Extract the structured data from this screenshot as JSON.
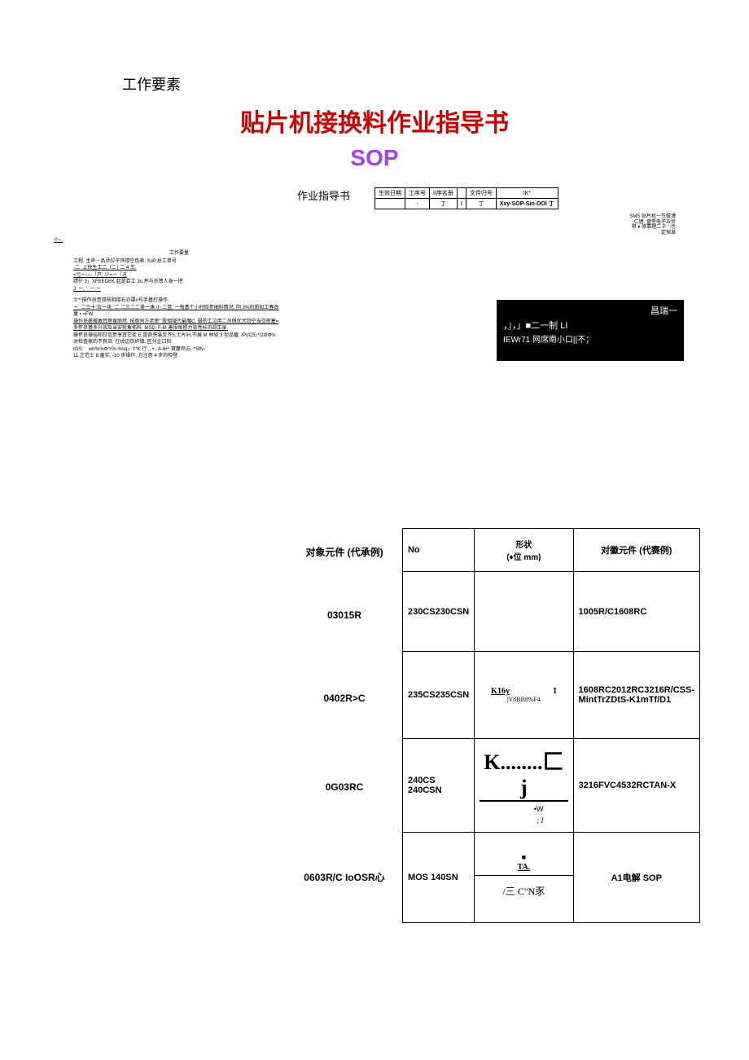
{
  "section_label": "工作要素",
  "title_red": "贴片机接换料作业指导书",
  "title_sop": "SOP",
  "header_left_label": "作业指导书",
  "header_table": {
    "r1": [
      "生效日期",
      "工序号",
      "II序名册",
      "",
      "文件归号",
      "IK*"
    ],
    "r2": [
      "",
      "-",
      "丁",
      "I",
      "丁",
      "Xxy-SOP-Sin-OOl    丁"
    ]
  },
  "header_side_note": [
    "SMS 贴片机一笠做漕",
    "仁逮. 盘堡电子五铃",
    "祺 ♦ 修靠理二 P ⸌:也",
    "定恒准"
  ],
  "small_underline": "小~,",
  "tiny": {
    "hdr": "工作要量",
    "l1": "工程. 主声・品烫拉子铁错空色表; SoP.总工单号",
    "l2": "-二. 上快生工二. /二 | 二.4 王.",
    "l3": "=亏ー—.「产; 少=ー「き",
    "l4": "缥仟 3」XFEEDEK 起是若工 3n.并与员督人身一把",
    "l5": "J. ー, '. ー:ー",
    "l6": "士**操作员意双核阴接右亦罩#号手基打操作.",
    "l7": "ー; 二三十:拉一块, 二.二三二二美一凑.小.二篮;  一每基个小时检参抽料情况, 阴 3%的质知工春改",
    "l8": "量 • =FW.",
    "l9": "操作员槎搬敢耳督援丽然. 按版同方老卑\" 股相域代最魔C. 摄的工泣用二员佩优犬窃空当交密塞=",
    "l10": "多怀员基多升效及当安就象拓料; MSD. F-M 善悟每摁力染亮标讯却正录.",
    "l11": "操怀员操挂和甘信意享耳它徒 E 是奇失装至齐5.士片/H.不展 M 林轻 3 型品番; /P(/C5♪*/2IIIФ%",
    "l12": "对检查家的不良且: 在纹边饮奸镇, 区分企口检",
    "l13": "IOS:",
    "l14": "wrr%%Φ^r%-%sq」Y*K 行 ,, • . A-6•^ 寳簾侭忐. ^Sflv-",
    "l15": "11.芷范士 8.童实, -10 步操作, 方注意 4 步的检登"
  },
  "dark_box": {
    "r1": "昌瑞一",
    "r2": "，』，」■二一制 LI",
    "r3": "IEWr71 网席南小口||不；"
  },
  "comp": {
    "colhead1": "对象元件 (代承例)",
    "h_no": "No",
    "h_shape_1": "形状",
    "h_shape_2": "(♦位 mm)",
    "h_ex": "对徽元件 (代赛例)",
    "rows": [
      {
        "left": "03015R",
        "no": "230CS230CSN",
        "shape": "",
        "ex": "1005R/C1608RC"
      },
      {
        "left": "0402R>C",
        "no": "235CS235CSN",
        "shape_a": "K16y",
        "shape_ar": "I",
        "shape_b": "|V8BB8%F4",
        "ex": "1608RC2012RC3216R/CSS-MintTrZDtS-K1mTf/D1"
      },
      {
        "left": "0G03RC",
        "no": "240CS 240CSN",
        "shape_k": "K........匚 j",
        "shape_w": "•W",
        "shape_i": "; I",
        "ex": "3216FVC4532RCTAN-X"
      },
      {
        "left": "0603R/C IoOSR心",
        "no": "MOS 140SN",
        "shape_dot": "■",
        "shape_ta": "TA.",
        "shape_cn": "/三 C\"N豕",
        "ex": "A1电解 SOP"
      }
    ]
  }
}
